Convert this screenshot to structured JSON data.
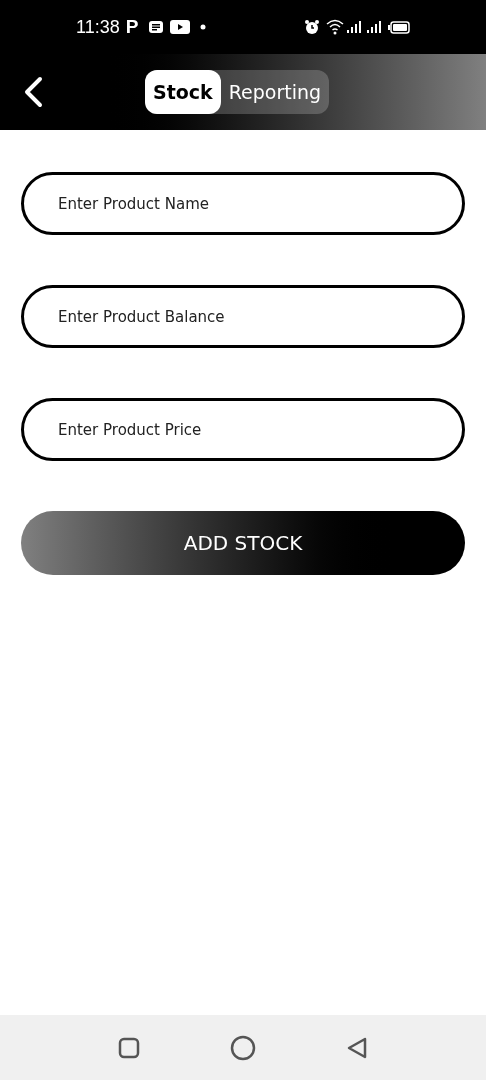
{
  "status_bar": {
    "time": "11:38",
    "notification_letter": "P"
  },
  "header": {
    "tabs": [
      {
        "label": "Stock",
        "selected": true
      },
      {
        "label": "Reporting",
        "selected": false
      }
    ]
  },
  "form": {
    "fields": [
      {
        "placeholder": "Enter Product Name"
      },
      {
        "placeholder": "Enter Product Balance"
      },
      {
        "placeholder": "Enter Product Price"
      }
    ],
    "submit": "ADD STOCK"
  }
}
